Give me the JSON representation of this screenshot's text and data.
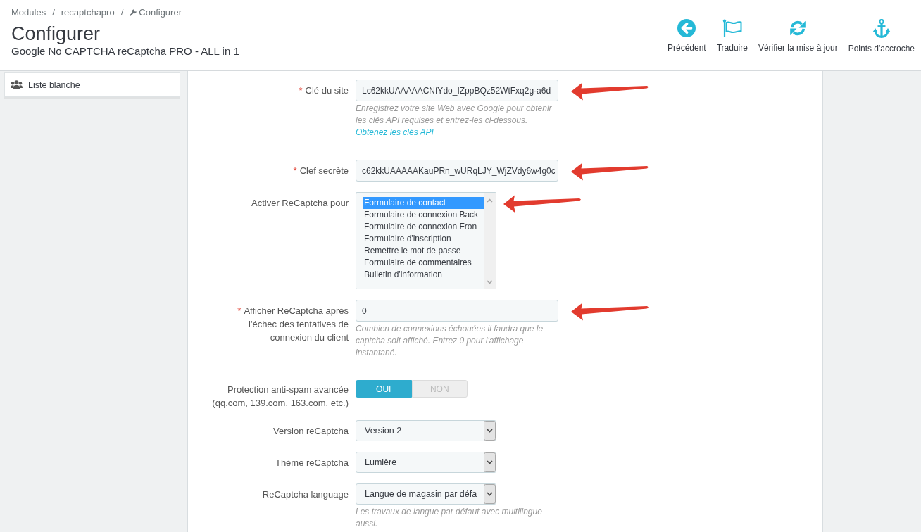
{
  "breadcrumb": [
    {
      "label": "Modules",
      "kind": "link",
      "separator": "/"
    },
    {
      "label": "recaptchapro",
      "kind": "link",
      "separator": "/"
    },
    {
      "label": "Configurer",
      "kind": "current"
    }
  ],
  "page_title": "Configurer",
  "subtitle": "Google No CAPTCHA reCaptcha PRO - ALL in 1",
  "toolbar": [
    {
      "label": "Précédent",
      "kind": "back"
    },
    {
      "label": "Traduire",
      "kind": "translate"
    },
    {
      "label": "Vérifier la mise à jour",
      "kind": "update"
    },
    {
      "label": "Points d'accroche",
      "kind": "hooks"
    }
  ],
  "sidebar": {
    "items": [
      {
        "label": "Liste blanche",
        "selected": false
      }
    ]
  },
  "form": {
    "fields": [
      {
        "kind": "text",
        "required_mark": "*",
        "label": "Clé du site",
        "value": "Lc62kkUAAAAACNfYdo_IZppBQz52WtFxq2g-a6d",
        "help": {
          "text": "Enregistrez votre site Web avec Google pour obtenir les clés API requises et entrez-les ci-dessous.",
          "link": "Obtenez les clés API"
        },
        "arrow": true
      },
      {
        "kind": "text",
        "required_mark": "*",
        "label": "Clef secrète",
        "value": "c62kkUAAAAAKauPRn_wURqLJY_WjZVdy6w4g0c",
        "arrow": true
      },
      {
        "kind": "listbox",
        "label": "Activer ReCaptcha pour",
        "options": [
          {
            "label": "Formulaire de contact",
            "selected": true
          },
          {
            "label": "Formulaire de connexion Back",
            "selected": false
          },
          {
            "label": "Formulaire de connexion Fron",
            "selected": false
          },
          {
            "label": "Formulaire d'inscription",
            "selected": false
          },
          {
            "label": "Remettre le mot de passe",
            "selected": false
          },
          {
            "label": "Formulaire de commentaires",
            "selected": false
          },
          {
            "label": "Bulletin d'information",
            "selected": false
          }
        ],
        "arrow": true
      },
      {
        "kind": "text",
        "required_mark": "*",
        "label": "Afficher ReCaptcha après l'échec des tentatives de connexion du client",
        "value": "0",
        "help": {
          "text": "Combien de connexions échouées il faudra que le captcha soit affiché. Entrez 0 pour l'affichage instantané."
        },
        "arrow": true
      },
      {
        "kind": "switch",
        "label": "Protection anti-spam avancée (qq.com, 139.com, 163.com, etc.)",
        "options": [
          {
            "label": "OUI",
            "selected": true
          },
          {
            "label": "NON",
            "selected": false
          }
        ],
        "arrow": false
      },
      {
        "kind": "select",
        "label": "Version reCaptcha",
        "value": "Version 2",
        "arrow": false
      },
      {
        "kind": "select",
        "label": "Thème reCaptcha",
        "value": "Lumière",
        "arrow": false
      },
      {
        "kind": "select",
        "label": "ReCaptcha language",
        "value": "Langue de magasin par défa",
        "help": {
          "text": "Les travaux de langue par défaut avec multilingue aussi."
        },
        "arrow": false
      }
    ]
  }
}
